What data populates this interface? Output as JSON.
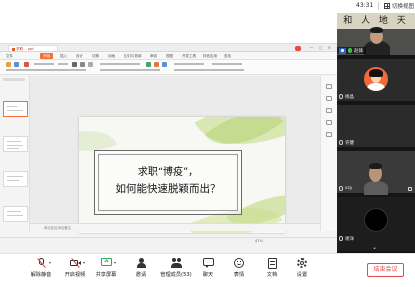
{
  "meeting": {
    "timer": "43:31",
    "switch_view_label": "切换视图",
    "end_button_label": "结束会议"
  },
  "wps": {
    "doc_tab_label": "求职... ppt",
    "badge_label": "",
    "menu_items": [
      "文件",
      "开始",
      "插入",
      "设计",
      "切换",
      "动画",
      "幻灯片放映",
      "审阅",
      "视图",
      "开发工具",
      "特色应用",
      "查找"
    ],
    "notes_placeholder": "单击此处添加备注",
    "zoom": "47%"
  },
  "slide": {
    "title_line1": "求职“博疫”，",
    "title_line2": "如何能快速脱颖而出？"
  },
  "participants": [
    {
      "name": "赵锋",
      "host": true,
      "mic": "on",
      "type": "video",
      "banner": "和 人 地 天"
    },
    {
      "name": "杨晶",
      "host": false,
      "mic": "muted",
      "type": "avatar"
    },
    {
      "name": "许健",
      "host": false,
      "mic": "muted",
      "type": "empty"
    },
    {
      "name": "szy",
      "host": false,
      "mic": "muted",
      "type": "video"
    },
    {
      "name": "谢洋",
      "host": false,
      "mic": "muted",
      "type": "dark"
    }
  ],
  "toolbar": {
    "unmute": "解除静音",
    "video": "开启视频",
    "share": "共享屏幕",
    "invite": "邀请",
    "members": "管理成员(53)",
    "chat": "聊天",
    "emoji": "表情",
    "docs": "文档",
    "settings": "设置"
  },
  "colors": {
    "accent_red": "#e34c4c",
    "share_green": "#2cae57",
    "host_blue": "#2e63c9",
    "wps_orange": "#f07236"
  }
}
